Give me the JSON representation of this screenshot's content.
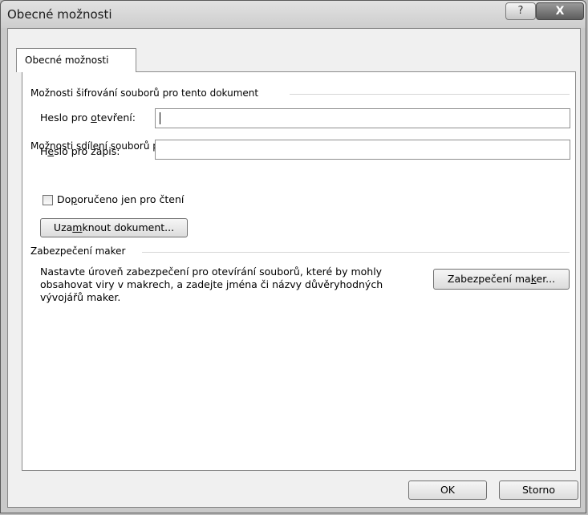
{
  "window": {
    "title": "Obecné možnosti",
    "help_label": "?",
    "close_label": "X"
  },
  "tab": {
    "label": "Obecné možnosti"
  },
  "encryption": {
    "group_label": "Možnosti šifrování souborů pro tento dokument",
    "open_password": {
      "pre": "Heslo pro ",
      "accel": "o",
      "post": "tevření:",
      "value": ""
    }
  },
  "sharing": {
    "group_label": "Možnosti sdílení souborů pro tento dokument",
    "modify_password": {
      "pre": "H",
      "accel": "e",
      "post": "slo pro zápis:",
      "value": ""
    },
    "readonly": {
      "pre": "Do",
      "accel": "p",
      "post": "oručeno jen pro čtení",
      "checked": false
    },
    "protect_button": {
      "pre": "Uza",
      "accel": "m",
      "post": "knout dokument..."
    }
  },
  "macro": {
    "group_label": "Zabezpečení maker",
    "description_lines": [
      "Nastavte úroveň zabezpečení pro otevírání souborů, které by mohly",
      "obsahovat viry v makrech, a zadejte jména či názvy důvěryhodných",
      "vývojářů maker."
    ],
    "button": {
      "pre": "Zabezpečení ma",
      "accel": "k",
      "post": "er..."
    }
  },
  "footer": {
    "ok_label": "OK",
    "cancel_label": "Storno"
  }
}
